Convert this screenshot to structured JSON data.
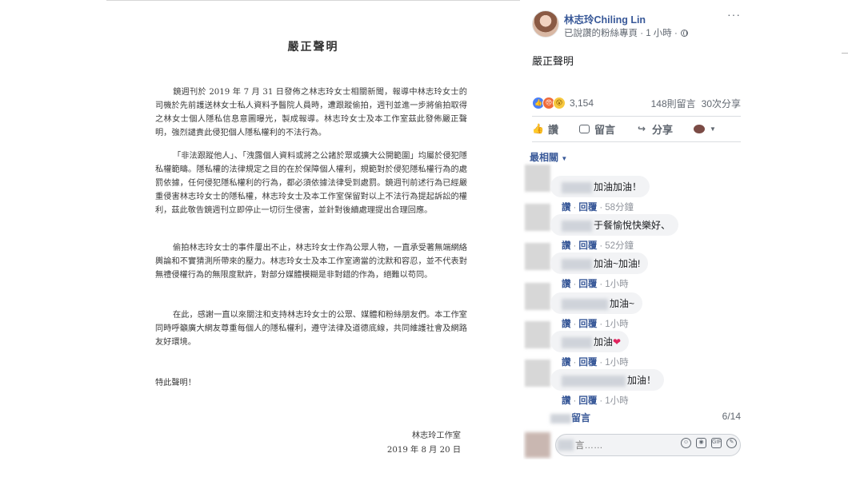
{
  "statement": {
    "title": "嚴正聲明",
    "paragraphs": [
      "鏡週刊於 2019 年 7 月 31 日發佈之林志玲女士相關新聞，報導中林志玲女士的司機於先前護送林女士私人資料予醫院人員時，遭跟蹤偷拍，週刊並進一步將偷拍取得之林女士個人隱私信息意圖曝光，製成報導。林志玲女士及本工作室茲此發佈嚴正聲明，強烈譴責此侵犯個人隱私權利的不法行為。",
      "「非法跟蹤他人」、「洩露個人資料或將之公諸於眾或擴大公開範圍」均屬於侵犯隱私權範疇。隱私權的法律規定之目的在於保障個人權利，規範對於侵犯隱私權行為的處罰依據，任何侵犯隱私權利的行為，都必須依據法律受到處罰。鏡週刊前述行為已經嚴重侵害林志玲女士的隱私權，林志玲女士及本工作室保留對以上不法行為提起訴訟的權利，茲此敬告鏡週刊立即停止一切衍生侵害，並針對後續處理提出合理回應。",
      "偷拍林志玲女士的事件屢出不止，林志玲女士作為公眾人物，一直承受著無端網絡輿論和不實猜測所帶來的壓力。林志玲女士及本工作室適當的沈默和容忍，並不代表對無禮侵權行為的無限度默許，對部分媒體模糊是非對錯的作為，絕難以苟同。",
      "在此，感謝一直以來關注和支持林志玲女士的公眾、媒體和粉絲朋友們。本工作室同時呼籲廣大網友尊重每個人的隱私權利，遵守法律及道德底線，共同維護社會及網路友好環境。"
    ],
    "closing": "特此聲明！",
    "signature": "林志玲工作室",
    "date": "2019 年 8 月 20 日"
  },
  "post": {
    "author": "林志玲Chiling Lin",
    "meta": "已說讚的粉絲專頁 · 1 小時 ·",
    "more": "···",
    "text": "嚴正聲明",
    "reaction_count": "3,154",
    "comments_count": "148則留言",
    "shares_count": "30次分享",
    "actions": {
      "like": "讚",
      "comment": "留言",
      "share": "分享"
    },
    "sort_label": "最相關",
    "comments": [
      {
        "text": "加油加油！",
        "time": "58分鐘"
      },
      {
        "text": "于餐愉悅快樂好、",
        "time": "52分鐘"
      },
      {
        "text": "加油~加油!",
        "time": "1小時"
      },
      {
        "text": "加油~",
        "time": "1小時"
      },
      {
        "text": "加油",
        "time": "1小時",
        "heart": true
      },
      {
        "text": "加油！",
        "time": "1小時"
      }
    ],
    "comment_like": "讚",
    "comment_reply": "回覆",
    "more_comments": "留言",
    "pager": "6/14",
    "composer_placeholder": "言……",
    "icons": [
      "globe-icon",
      "like-icon",
      "comment-icon",
      "share-icon",
      "emoji-icon",
      "camera-icon",
      "gif-icon",
      "sticker-icon"
    ],
    "colors": {
      "link": "#385898",
      "secondary": "#606770",
      "bubble": "#f2f3f5",
      "heart": "#e0245e"
    }
  }
}
